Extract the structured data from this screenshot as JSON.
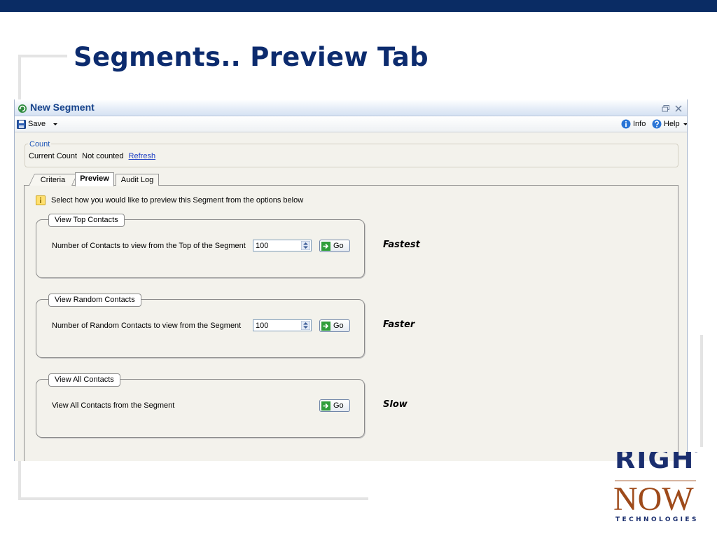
{
  "slide": {
    "title": "Segments.. Preview Tab",
    "colors": {
      "top_bar": "#0a2c64",
      "title": "#0c2b6e"
    }
  },
  "logo": {
    "word_top": "RIGHT",
    "word_main": "NOW",
    "word_sub": "TECHNOLOGIES",
    "colors": {
      "navy": "#1a2e6e",
      "rust": "#9e4a1a"
    }
  },
  "window": {
    "title": "New Segment",
    "icons": {
      "app": "refresh-circle-icon",
      "restore": "restore-window-icon",
      "close": "close-icon"
    }
  },
  "toolbar": {
    "save_label": "Save",
    "info_label": "Info",
    "help_label": "Help",
    "icons": {
      "save": "floppy-disk-icon",
      "info": "info-icon",
      "help": "help-icon",
      "dropdown": "chevron-down-icon"
    }
  },
  "count": {
    "legend": "Count",
    "current_count_label": "Current Count",
    "current_count_value": "Not counted",
    "refresh_link": "Refresh"
  },
  "tabs": [
    {
      "label": "Criteria",
      "active": false
    },
    {
      "label": "Preview",
      "active": true
    },
    {
      "label": "Audit Log",
      "active": false
    }
  ],
  "preview": {
    "info_text": "Select how you would like to preview this Segment from the options below",
    "go_label": "Go",
    "options": [
      {
        "caption": "View Top Contacts",
        "label": "Number of Contacts to view from the Top of the Segment",
        "value": "100",
        "speed": "Fastest"
      },
      {
        "caption": "View Random Contacts",
        "label": "Number of Random Contacts to view from the Segment",
        "value": "100",
        "speed": "Faster"
      },
      {
        "caption": "View All Contacts",
        "label": "View All Contacts from the Segment",
        "speed": "Slow"
      }
    ]
  }
}
